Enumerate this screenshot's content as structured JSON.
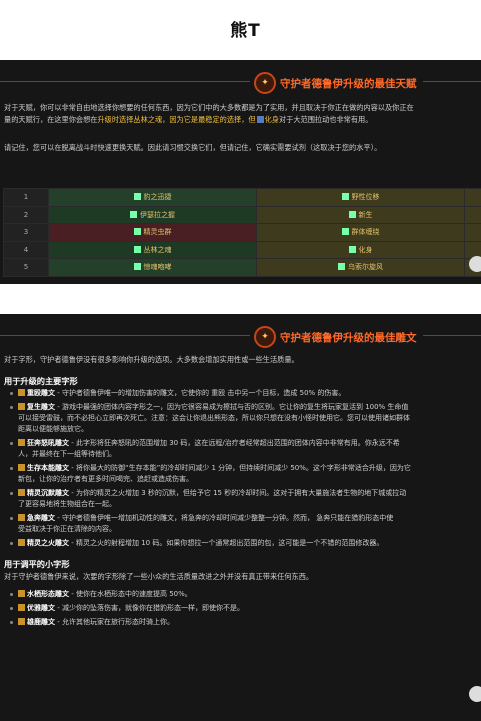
{
  "brand": {
    "text": "熊T"
  },
  "talents_section": {
    "title": "守护者德鲁伊升级的最佳天赋",
    "intro_line1": "对于天赋，你可以非常自由地选择你想要的任何东西，因为它们中的大多数都是为了实用，并且取决于你正在做的内容以及你正在",
    "intro_line2_pre": "量的天赋行，在这里你会想在",
    "intro_line2_hl": "升级时选择丛林之魂，因为它是最稳定的选择，但",
    "intro_line2_hl2": "化身",
    "intro_line2_post": "对于大范围拉动也非常有用。",
    "note": "请记住，您可以在脱离战斗时快速更换天赋。因此请习惯交换它们，但请记住，它确实需要试剂（这取决于您的水平）。",
    "rows": [
      {
        "num": "1",
        "a": "豹之迅捷",
        "b": "野性位移"
      },
      {
        "num": "2",
        "a": "伊瑟拉之握",
        "b": "新生"
      },
      {
        "num": "3",
        "a": "精灵虫群",
        "b": "群体缠绕"
      },
      {
        "num": "4",
        "a": "丛林之魂",
        "b": "化身"
      },
      {
        "num": "5",
        "a": "惊魂咆哮",
        "b": "乌索尔旋风"
      }
    ]
  },
  "glyphs_section": {
    "title": "守护者德鲁伊升级的最佳雕文",
    "intro": "对于字形，守护者德鲁伊没有很多影响你升级的选项。大多数会增加实用性或一些生活质量。",
    "major_heading": "用于升级的主要字形",
    "major": [
      {
        "name": "重殴雕文",
        "l1": " - 守护者德鲁伊唯一的增加伤害的雕文，它使你的 重殴 击中另一个目标，造成 50% 的伤害。",
        "l2": ""
      },
      {
        "name": "复生雕文",
        "l1": " - 游戏中最强的团体内容字形之一，因为它很容易成为擦拭与否的区别。它让你的复生将玩家复活到 100% 生命值",
        "l2": "可以接受雷鼓，而不必担心立即再次死亡。注意：这会让你退出熊形态，所以你只想在没有小怪时使用它。您可以使用诸如群体",
        "l3": "距离以便能够施放它。"
      },
      {
        "name": "狂奔怒吼雕文",
        "l1": " - 此字形将狂奔怒吼的范围增加 30 码，这在远程/治疗者经常超出范围的团体内容中非常有用。你永远不希",
        "l2": "人，并最终在下一组等待他们。"
      },
      {
        "name": "生存本能雕文",
        "l1": " - 将你最大的防御“生存本能”的冷却时间减少 1 分钟，但持续时间减少 50%。这个字形非常适合升级，因为它",
        "l2": "新包，让你的治疗者有更多时间喝完、追赶或造成伤害。"
      },
      {
        "name": "精灵沉默雕文",
        "l1": " - 为你的精灵之火增加 3 秒的沉默，但给予它 15 秒的冷却时间。这对于拥有大量施法者生物的地下城或拉动",
        "l2": "了更容易地将生物组合在一起。"
      },
      {
        "name": "急奔雕文",
        "l1": " - 守护者德鲁伊唯一增加机动性的雕文，将急奔的冷却时间减少整整一分钟。然而， 急奔只能在猎豹形态中使",
        "l2": "受益取决于你正在清除的内容。"
      },
      {
        "name": "精灵之火雕文",
        "l1": " - 精灵之火的射程增加 10 码。如果你想拉一个通常超出范围的包，这可能是一个不错的范围修改器。",
        "l2": ""
      }
    ],
    "minor_heading": "用于调平的小字形",
    "minor_intro": "对于守护者德鲁伊来说，次要的字形除了一些小众的生活质量改进之外并没有真正带来任何东西。",
    "minor": [
      {
        "name": "水栖形态雕文",
        "text": " - 使你在水栖形态中的速度提高 50%。"
      },
      {
        "name": "优雅雕文",
        "text": " - 减少你的坠落伤害，就像你在猎豹形态一样，即使你不是。"
      },
      {
        "name": "雄鹿雕文",
        "text": " - 允许其他玩家在旅行形态时骑上你。"
      }
    ]
  }
}
